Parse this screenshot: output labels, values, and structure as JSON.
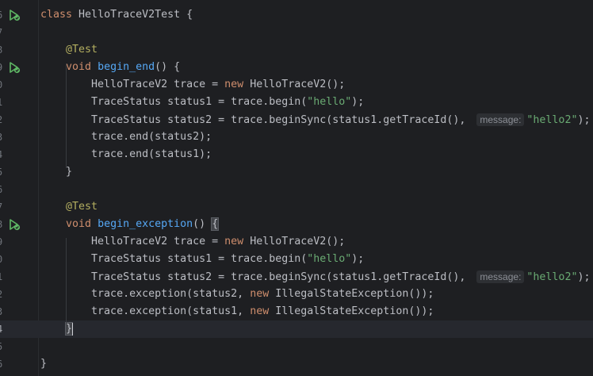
{
  "editor": {
    "lines": [
      {
        "num": "6",
        "segments": [
          {
            "t": "kw",
            "v": "class "
          },
          {
            "t": "plain",
            "v": "HelloTraceV2Test {"
          }
        ],
        "run": true
      },
      {
        "num": "7",
        "segments": []
      },
      {
        "num": "8",
        "segments": [
          {
            "t": "plain",
            "v": "    "
          },
          {
            "t": "ann",
            "v": "@Test"
          }
        ]
      },
      {
        "num": "9",
        "segments": [
          {
            "t": "plain",
            "v": "    "
          },
          {
            "t": "kw",
            "v": "void "
          },
          {
            "t": "fn",
            "v": "begin_end"
          },
          {
            "t": "plain",
            "v": "() {"
          }
        ],
        "run": true
      },
      {
        "num": "0",
        "segments": [
          {
            "t": "plain",
            "v": "        HelloTraceV2 trace = "
          },
          {
            "t": "kw",
            "v": "new "
          },
          {
            "t": "plain",
            "v": "HelloTraceV2();"
          }
        ]
      },
      {
        "num": "1",
        "segments": [
          {
            "t": "plain",
            "v": "        TraceStatus status1 = trace.begin("
          },
          {
            "t": "str",
            "v": "\"hello\""
          },
          {
            "t": "plain",
            "v": ");"
          }
        ]
      },
      {
        "num": "2",
        "segments": [
          {
            "t": "plain",
            "v": "        TraceStatus status2 = trace.beginSync(status1.getTraceId(), "
          },
          {
            "t": "hint",
            "v": "message:"
          },
          {
            "t": "str",
            "v": "\"hello2\""
          },
          {
            "t": "plain",
            "v": ");"
          }
        ]
      },
      {
        "num": "3",
        "segments": [
          {
            "t": "plain",
            "v": "        trace.end(status2);"
          }
        ]
      },
      {
        "num": "4",
        "segments": [
          {
            "t": "plain",
            "v": "        trace.end(status1);"
          }
        ]
      },
      {
        "num": "5",
        "segments": [
          {
            "t": "plain",
            "v": "    }"
          }
        ]
      },
      {
        "num": "6",
        "segments": []
      },
      {
        "num": "7",
        "segments": [
          {
            "t": "plain",
            "v": "    "
          },
          {
            "t": "ann",
            "v": "@Test"
          }
        ]
      },
      {
        "num": "8",
        "segments": [
          {
            "t": "plain",
            "v": "    "
          },
          {
            "t": "kw",
            "v": "void "
          },
          {
            "t": "fn",
            "v": "begin_exception"
          },
          {
            "t": "plain",
            "v": "() "
          },
          {
            "t": "match",
            "v": "{"
          }
        ],
        "run": true
      },
      {
        "num": "9",
        "segments": [
          {
            "t": "plain",
            "v": "        HelloTraceV2 trace = "
          },
          {
            "t": "kw",
            "v": "new "
          },
          {
            "t": "plain",
            "v": "HelloTraceV2();"
          }
        ]
      },
      {
        "num": "0",
        "segments": [
          {
            "t": "plain",
            "v": "        TraceStatus status1 = trace.begin("
          },
          {
            "t": "str",
            "v": "\"hello\""
          },
          {
            "t": "plain",
            "v": ");"
          }
        ]
      },
      {
        "num": "1",
        "segments": [
          {
            "t": "plain",
            "v": "        TraceStatus status2 = trace.beginSync(status1.getTraceId(), "
          },
          {
            "t": "hint",
            "v": "message:"
          },
          {
            "t": "str",
            "v": "\"hello2\""
          },
          {
            "t": "plain",
            "v": ");"
          }
        ]
      },
      {
        "num": "2",
        "segments": [
          {
            "t": "plain",
            "v": "        trace.exception(status2, "
          },
          {
            "t": "kw",
            "v": "new "
          },
          {
            "t": "plain",
            "v": "IllegalStateException());"
          }
        ]
      },
      {
        "num": "3",
        "segments": [
          {
            "t": "plain",
            "v": "        trace.exception(status1, "
          },
          {
            "t": "kw",
            "v": "new "
          },
          {
            "t": "plain",
            "v": "IllegalStateException());"
          }
        ]
      },
      {
        "num": "4",
        "segments": [
          {
            "t": "plain",
            "v": "    "
          },
          {
            "t": "match",
            "v": "}"
          }
        ],
        "current": true
      },
      {
        "num": "5",
        "segments": []
      },
      {
        "num": "6",
        "segments": [
          {
            "t": "plain",
            "v": "}"
          }
        ]
      }
    ],
    "run_icon": "run-test-icon",
    "colors": {
      "background": "#1e1f22",
      "keyword": "#cf8e6d",
      "annotation": "#b3ae60",
      "function": "#56a8f5",
      "string": "#6aab73",
      "run_icon": "#5fb865"
    }
  }
}
